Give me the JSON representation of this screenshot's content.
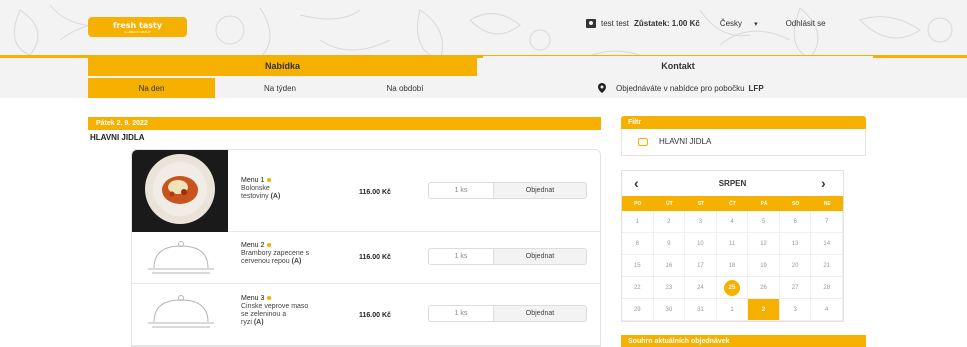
{
  "logo": {
    "text": "fresh tasty",
    "sub": "by ABROK GROUP"
  },
  "user": {
    "name": "test test",
    "balance_label": "Zůstatek: 1.00 Kč",
    "language": "Česky",
    "lang_arrow": "▾",
    "logout": "Odhlásit se"
  },
  "nav": {
    "tabs": [
      {
        "label": "Nabídka"
      },
      {
        "label": "Kontakt"
      }
    ]
  },
  "subnav": {
    "items": [
      {
        "label": "Na den"
      },
      {
        "label": "Na týden"
      },
      {
        "label": "Na období"
      }
    ],
    "branch_text": "Objednáváte v nabídce pro pobočku",
    "branch_code": "LFP"
  },
  "main": {
    "date": "Pátek 2. 9. 2022",
    "category": "HLAVNI JIDLA",
    "menus": [
      {
        "name": "Menu 1",
        "desc_lines": [
          "Bolonske",
          "testoviny"
        ],
        "allergen": "(A)",
        "price": "116.00 Kč",
        "qty": "1 ks",
        "order": "Objednat"
      },
      {
        "name": "Menu 2",
        "desc_lines": [
          "Brambory zapecene s",
          "cervenou repou"
        ],
        "allergen": "(A)",
        "price": "116.00 Kč",
        "qty": "1 ks",
        "order": "Objednat"
      },
      {
        "name": "Menu 3",
        "desc_lines": [
          "Cinske veprove maso",
          "se zeleninou a",
          "ryzi"
        ],
        "allergen": "(A)",
        "price": "116.00 Kč",
        "qty": "1 ks",
        "order": "Objednat"
      }
    ]
  },
  "sidebar": {
    "filter_title": "Filtr",
    "filter_items": [
      {
        "label": "HLAVNI JIDLA"
      }
    ],
    "calendar": {
      "month": "SRPEN",
      "prev": "‹",
      "next": "›",
      "weekdays": [
        "PO",
        "ÚT",
        "ST",
        "ČT",
        "PÁ",
        "SO",
        "NE"
      ],
      "days": [
        "1",
        "2",
        "3",
        "4",
        "5",
        "6",
        "7",
        "8",
        "9",
        "10",
        "11",
        "12",
        "13",
        "14",
        "15",
        "16",
        "17",
        "18",
        "19",
        "20",
        "21",
        "22",
        "23",
        "24",
        "25",
        "26",
        "27",
        "28",
        "29",
        "30",
        "31",
        "1",
        "2",
        "3",
        "4"
      ],
      "today_index": 24,
      "selected_index": 32
    },
    "summary_title": "Souhrn aktuálních objednávek"
  },
  "colors": {
    "accent": "#f6b100",
    "header_bg": "#f3f3f3"
  }
}
